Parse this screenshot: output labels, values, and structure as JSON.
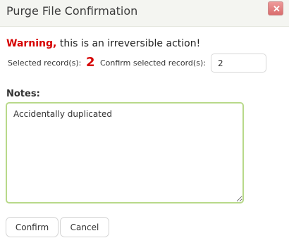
{
  "dialog": {
    "title": "Purge File Confirmation",
    "close_glyph": "✕"
  },
  "warning": {
    "label": "Warning,",
    "text": " this is an irreversible action!"
  },
  "selection": {
    "selected_label": "Selected record(s):",
    "selected_count": "2",
    "confirm_label": "Confirm selected record(s):",
    "confirm_value": "2"
  },
  "notes": {
    "label": "Notes:",
    "value": "Accidentally duplicated"
  },
  "buttons": {
    "confirm_label": "Confirm",
    "cancel_label": "Cancel"
  },
  "colors": {
    "warning": "#d60000",
    "notes_border": "#b8d98a",
    "close_button": "#d96d6d",
    "titlebar_bg": "#f4f5f1"
  }
}
